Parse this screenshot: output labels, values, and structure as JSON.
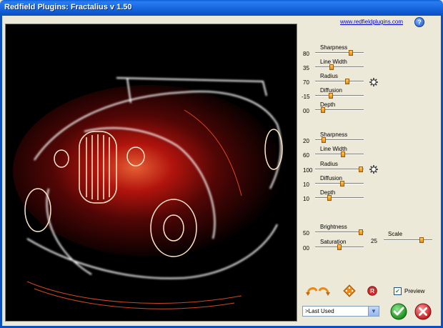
{
  "window": {
    "title": "Redfield Plugins: Fractalius v 1.50"
  },
  "header": {
    "link": "www.redfieldplugins.com",
    "help_glyph": "?"
  },
  "group1": [
    {
      "label": "Sharpness",
      "value": "80",
      "fraction": 0.74
    },
    {
      "label": "Line Width",
      "value": "35",
      "fraction": 0.34
    },
    {
      "label": "Radius",
      "value": "70",
      "fraction": 0.66
    },
    {
      "label": "Diffusion",
      "value": "-15",
      "fraction": 0.33
    },
    {
      "label": "Depth",
      "value": "00",
      "fraction": 0.16
    }
  ],
  "group2": [
    {
      "label": "Sharpness",
      "value": "20",
      "fraction": 0.18
    },
    {
      "label": "Line Width",
      "value": "60",
      "fraction": 0.57
    },
    {
      "label": "Radius",
      "value": "100",
      "fraction": 0.94
    },
    {
      "label": "Diffusion",
      "value": "10",
      "fraction": 0.56
    },
    {
      "label": "Depth",
      "value": "10",
      "fraction": 0.29
    }
  ],
  "group3": [
    {
      "label": "Brightness",
      "value": "50",
      "fraction": 0.94
    },
    {
      "label": "Saturation",
      "value": "00",
      "fraction": 0.5
    }
  ],
  "scale": {
    "label": "Scale",
    "value": "25",
    "fraction": 0.78
  },
  "preview": {
    "label": "Preview",
    "checked": true
  },
  "preset": {
    "selected": ">Last Used"
  },
  "colors": {
    "accent": "#e8891a",
    "ok": "#21a121",
    "cancel": "#d62b2b",
    "titlebar": "#0b4fc0"
  },
  "icons": [
    "undo-redo-icon",
    "randomize-icon",
    "reset-icon",
    "radius-gear-icon",
    "ok-icon",
    "cancel-icon"
  ]
}
